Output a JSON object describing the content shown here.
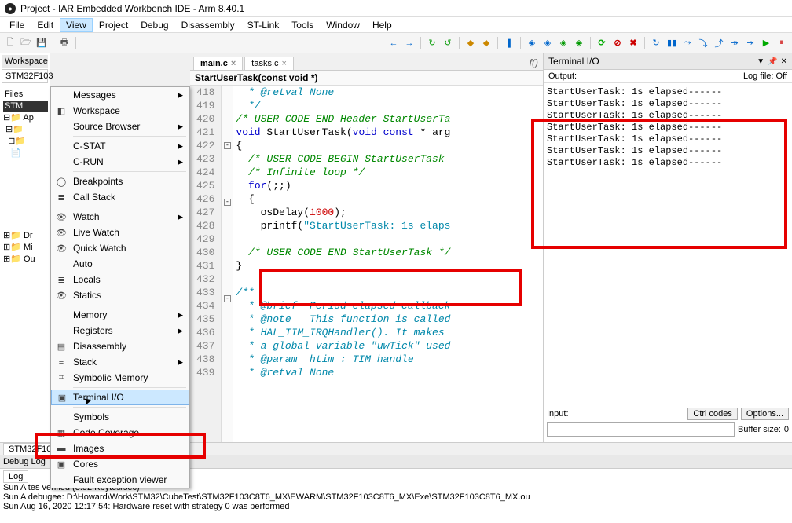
{
  "title": "Project - IAR Embedded Workbench IDE - Arm 8.40.1",
  "menubar": [
    "File",
    "Edit",
    "View",
    "Project",
    "Debug",
    "Disassembly",
    "ST-Link",
    "Tools",
    "Window",
    "Help"
  ],
  "view_menu": [
    {
      "label": "Messages",
      "arrow": true
    },
    {
      "label": "Workspace",
      "icon": "◧"
    },
    {
      "label": "Source Browser",
      "arrow": true
    },
    {
      "sep": true
    },
    {
      "label": "C-STAT",
      "arrow": true
    },
    {
      "label": "C-RUN",
      "arrow": true
    },
    {
      "sep": true
    },
    {
      "label": "Breakpoints",
      "icon": "◯"
    },
    {
      "label": "Call Stack",
      "icon": "≣"
    },
    {
      "sep": true
    },
    {
      "label": "Watch",
      "arrow": true,
      "icon": "👁"
    },
    {
      "label": "Live Watch",
      "icon": "👁"
    },
    {
      "label": "Quick Watch",
      "icon": "👁"
    },
    {
      "label": "Auto"
    },
    {
      "label": "Locals",
      "icon": "≣"
    },
    {
      "label": "Statics",
      "icon": "👁"
    },
    {
      "sep": true
    },
    {
      "label": "Memory",
      "arrow": true
    },
    {
      "label": "Registers",
      "arrow": true
    },
    {
      "label": "Disassembly",
      "icon": "▤"
    },
    {
      "label": "Stack",
      "arrow": true,
      "icon": "≡"
    },
    {
      "label": "Symbolic Memory",
      "icon": "⌗"
    },
    {
      "sep": true
    },
    {
      "label": "Terminal I/O",
      "highlighted": true,
      "icon": "▣"
    },
    {
      "sep": true
    },
    {
      "label": "Symbols"
    },
    {
      "label": "Code Coverage",
      "icon": "▦"
    },
    {
      "label": "Images",
      "icon": "▬"
    },
    {
      "label": "Cores",
      "icon": "▣"
    },
    {
      "label": "Fault exception viewer"
    }
  ],
  "workspace": {
    "tab": "Workspace",
    "config": "STM32F103",
    "files": "Files",
    "root": "STM",
    "nodes": [
      "Ap",
      "",
      "",
      "",
      "Dr",
      "Mi",
      "Ou"
    ]
  },
  "editor": {
    "tabs": [
      {
        "name": "main.c",
        "active": true
      },
      {
        "name": "tasks.c"
      }
    ],
    "func": "StartUserTask(const void *)",
    "lines": [
      {
        "n": 418,
        "t": "  * @retval None",
        "cls": "cm-doc"
      },
      {
        "n": 419,
        "t": "  */",
        "cls": "cm-doc"
      },
      {
        "n": 420,
        "t": "/* USER CODE END Header_StartUserTa",
        "cls": "cm"
      },
      {
        "n": 421,
        "t": "void StartUserTask(void const * arg",
        "kw": true
      },
      {
        "n": 422,
        "t": "{",
        "fold": "-"
      },
      {
        "n": 423,
        "t": "  /* USER CODE BEGIN StartUserTask",
        "cls": "cm"
      },
      {
        "n": 424,
        "t": "  /* Infinite loop */",
        "cls": "cm"
      },
      {
        "n": 425,
        "t": "  for(;;)",
        "kw2": true
      },
      {
        "n": 426,
        "t": "  {",
        "fold": "-"
      },
      {
        "n": 427,
        "t": "    osDelay(1000);",
        "hl": true
      },
      {
        "n": 428,
        "t": "    printf(\"StartUserTask: 1s elaps",
        "hl": true
      },
      {
        "n": 429,
        "t": ""
      },
      {
        "n": 430,
        "t": "  /* USER CODE END StartUserTask */",
        "cls": "cm"
      },
      {
        "n": 431,
        "t": "}"
      },
      {
        "n": 432,
        "t": ""
      },
      {
        "n": 433,
        "t": "/**",
        "cls": "cm-doc",
        "fold": "-"
      },
      {
        "n": 434,
        "t": "  * @brief  Period elapsed callback",
        "cls": "cm-doc"
      },
      {
        "n": 435,
        "t": "  * @note   This function is called",
        "cls": "cm-doc"
      },
      {
        "n": 436,
        "t": "  * HAL_TIM_IRQHandler(). It makes",
        "cls": "cm-doc"
      },
      {
        "n": 437,
        "t": "  * a global variable \"uwTick\" used",
        "cls": "cm-doc"
      },
      {
        "n": 438,
        "t": "  * @param  htim : TIM handle",
        "cls": "cm-doc"
      },
      {
        "n": 439,
        "t": "  * @retval None",
        "cls": "cm-doc"
      }
    ]
  },
  "terminal": {
    "title": "Terminal I/O",
    "output_label": "Output:",
    "logfile": "Log file: Off",
    "lines": [
      "StartUserTask: 1s elapsed------",
      "StartUserTask: 1s elapsed------",
      "StartUserTask: 1s elapsed------",
      "StartUserTask: 1s elapsed------",
      "StartUserTask: 1s elapsed------",
      "StartUserTask: 1s elapsed------",
      "StartUserTask: 1s elapsed------"
    ],
    "input_label": "Input:",
    "ctrl_codes": "Ctrl codes",
    "options": "Options...",
    "buffer_label": "Buffer size:",
    "buffer_val": "0"
  },
  "bottom": {
    "config_tab": "STM32F103",
    "debug_log": "Debug Log",
    "log_tab": "Log",
    "lines": [
      "Sun A                                                      tes verified (8.92 Kbytes/sec)",
      "Sun A                                                      debugee: D:\\Howard\\Work\\STM32\\CubeTest\\STM32F103C8T6_MX\\EWARM\\STM32F103C8T6_MX\\Exe\\STM32F103C8T6_MX.ou",
      "Sun Aug 16, 2020 12:17:54: Hardware reset with strategy 0 was performed"
    ]
  }
}
